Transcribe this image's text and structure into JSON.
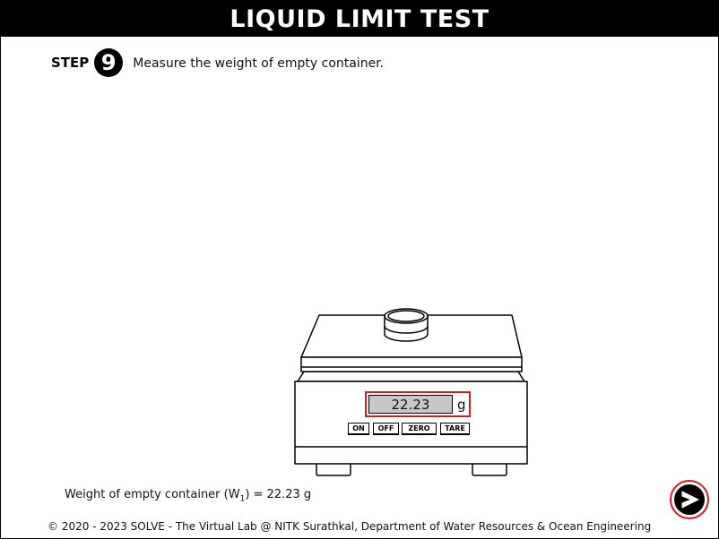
{
  "header": {
    "title": "LIQUID LIMIT TEST"
  },
  "step": {
    "label": "STEP",
    "number": "9",
    "instruction": "Measure the weight of empty container."
  },
  "balance": {
    "display_value": "22.23",
    "unit": "g",
    "buttons": {
      "on": "ON",
      "off": "OFF",
      "zero": "ZERO",
      "tare": "TARE"
    }
  },
  "result": {
    "prefix": "Weight of empty container (W",
    "subscript": "1",
    "suffix": ") = 22.23 g"
  },
  "footer": {
    "text": "© 2020 - 2023 SOLVE - The Virtual Lab @ NITK Surathkal, Department of Water Resources & Ocean Engineering"
  },
  "colors": {
    "highlight": "#d11b24",
    "title_bg": "#000000",
    "lcd_bg": "#c8c8c8"
  },
  "icons": {
    "next": "next-arrow-icon"
  }
}
